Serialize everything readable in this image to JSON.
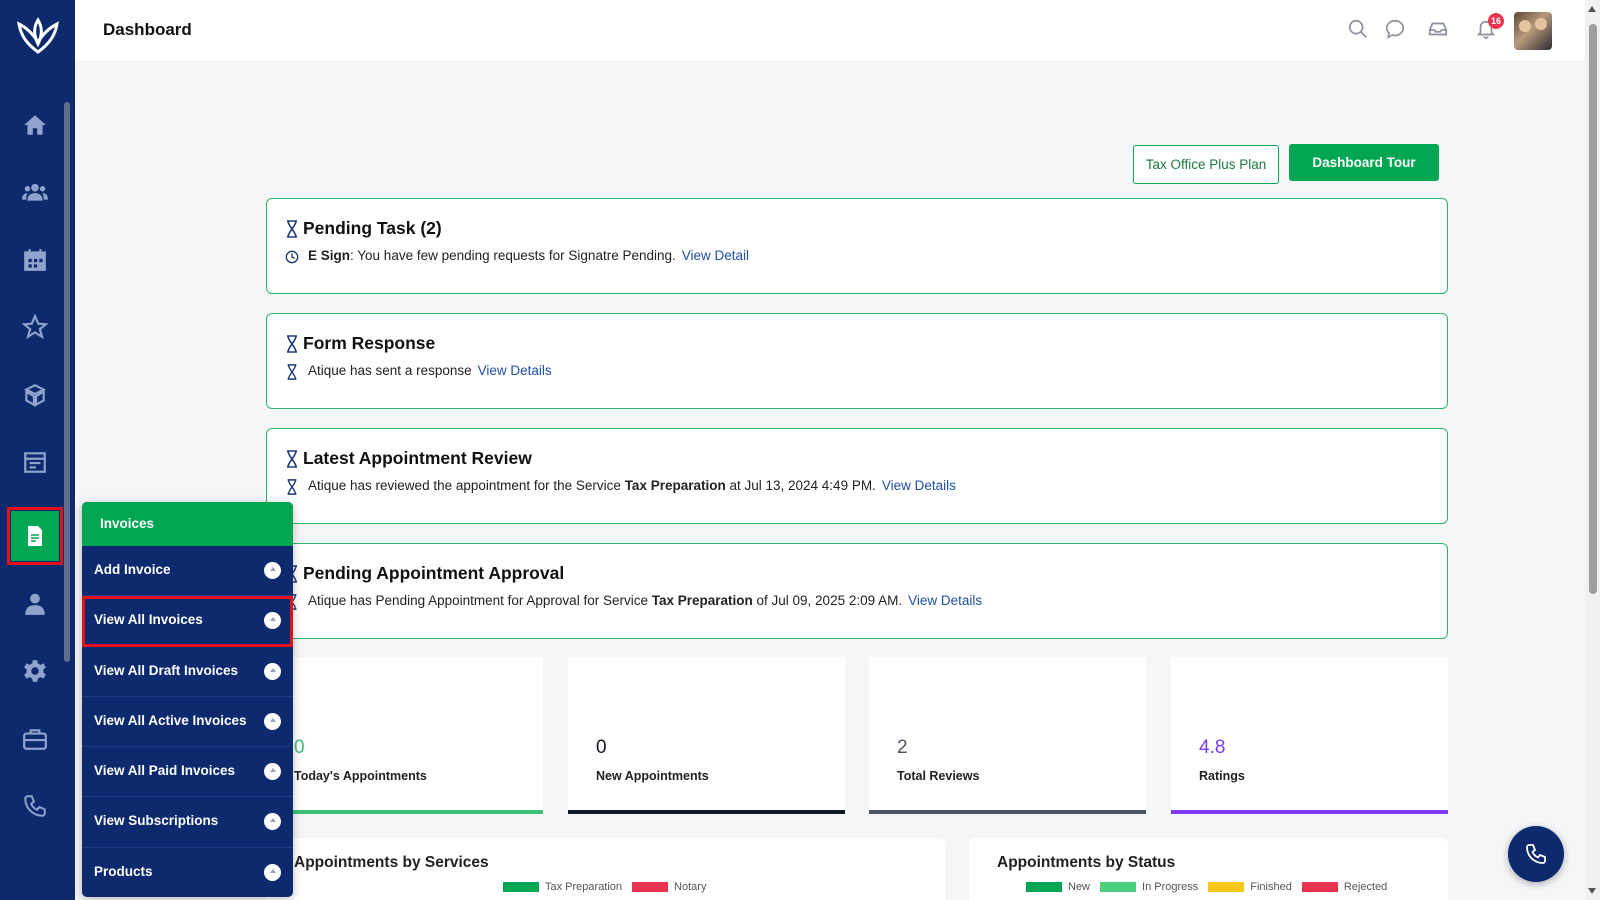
{
  "header": {
    "title": "Dashboard",
    "notification_count": "16"
  },
  "sidebar": {
    "items": [
      {
        "icon": "home-icon"
      },
      {
        "icon": "users-icon"
      },
      {
        "icon": "calendar-icon"
      },
      {
        "icon": "star-icon"
      },
      {
        "icon": "box-icon"
      },
      {
        "icon": "schedule-icon"
      },
      {
        "icon": "invoice-icon",
        "active": true
      },
      {
        "icon": "person-icon"
      },
      {
        "icon": "gear-icon"
      },
      {
        "icon": "briefcase-icon"
      },
      {
        "icon": "phone-icon"
      }
    ]
  },
  "actions": {
    "plan_label": "Tax Office Plus Plan",
    "tour_label": "Dashboard Tour"
  },
  "cards": [
    {
      "title": "Pending Task (2)",
      "bold": "E Sign",
      "text": ": You have few pending requests for Signatre Pending.",
      "link": "View Detail"
    },
    {
      "title": "Form Response",
      "text": "Atique has sent a response",
      "link": "View Details"
    },
    {
      "title": "Latest Appointment Review",
      "text_before": "Atique has reviewed the appointment for the Service ",
      "bold": "Tax Preparation",
      "text_after": " at Jul 13, 2024 4:49 PM.",
      "link": "View Details"
    },
    {
      "title": "Pending Appointment Approval",
      "text_before": "Atique has Pending Appointment for Approval for Service ",
      "bold": "Tax Preparation",
      "text_after": " of Jul 09, 2025 2:09 AM.",
      "link": "View Details"
    }
  ],
  "stats": [
    {
      "value": "0",
      "label": "Today's Appointments",
      "color": "#3ec07a"
    },
    {
      "value": "0",
      "label": "New Appointments",
      "color": "#111827"
    },
    {
      "value": "2",
      "label": "Total Reviews",
      "color": "#4b5563"
    },
    {
      "value": "4.8",
      "label": "Ratings",
      "color": "#7c3aed"
    }
  ],
  "panels": {
    "services": {
      "title": "Appointments by Services",
      "legend": [
        {
          "label": "Tax Preparation",
          "color": "#00a651"
        },
        {
          "label": "Notary",
          "color": "#e8344e"
        }
      ]
    },
    "status": {
      "title": "Appointments by Status",
      "legend": [
        {
          "label": "New",
          "color": "#00a651"
        },
        {
          "label": "In Progress",
          "color": "#4cd07d"
        },
        {
          "label": "Finished",
          "color": "#f5c518"
        },
        {
          "label": "Rejected",
          "color": "#e8344e"
        }
      ]
    }
  },
  "flyout": {
    "title": "Invoices",
    "items": [
      {
        "label": "Add Invoice"
      },
      {
        "label": "View All Invoices",
        "selected": true
      },
      {
        "label": "View All Draft Invoices"
      },
      {
        "label": "View All Active Invoices"
      },
      {
        "label": "View All Paid Invoices"
      },
      {
        "label": "View Subscriptions"
      },
      {
        "label": "Products"
      }
    ]
  }
}
